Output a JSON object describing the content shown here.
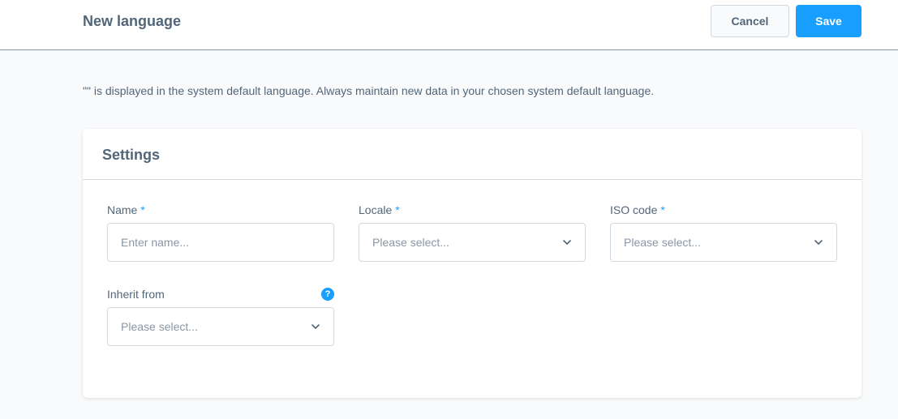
{
  "header": {
    "title": "New language",
    "cancel_label": "Cancel",
    "save_label": "Save"
  },
  "notice": "\"\" is displayed in the system default language. Always maintain new data in your chosen system default language.",
  "settings": {
    "title": "Settings",
    "name": {
      "label": "Name",
      "required_mark": "*",
      "placeholder": "Enter name..."
    },
    "locale": {
      "label": "Locale",
      "required_mark": "*",
      "value": "Please select..."
    },
    "iso_code": {
      "label": "ISO code",
      "required_mark": "*",
      "value": "Please select..."
    },
    "inherit_from": {
      "label": "Inherit from",
      "help_icon": "?",
      "value": "Please select..."
    }
  },
  "colors": {
    "accent": "#189eff",
    "text": "#52667a",
    "placeholder": "#8a96a3",
    "border": "#d1d9e0",
    "background": "#f9fafb"
  },
  "icons": {
    "dropdown": "chevron-down-icon",
    "help": "question-circle-icon"
  }
}
